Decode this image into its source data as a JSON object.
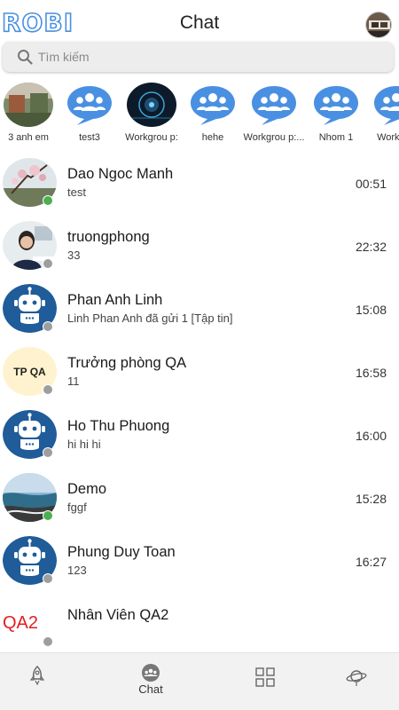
{
  "header": {
    "logo": "ROBI",
    "title": "Chat"
  },
  "search": {
    "placeholder": "Tìm kiếm"
  },
  "groups": [
    {
      "label": "3 anh em",
      "kind": "photo"
    },
    {
      "label": "test3",
      "kind": "group-icon"
    },
    {
      "label": "Workgrou p:",
      "kind": "photo"
    },
    {
      "label": "hehe",
      "kind": "group-icon"
    },
    {
      "label": "Workgrou p:...",
      "kind": "group-icon"
    },
    {
      "label": "Nhom 1",
      "kind": "group-icon"
    },
    {
      "label": "Workg p:",
      "kind": "group-icon"
    }
  ],
  "chats": [
    {
      "name": "Dao Ngoc Manh",
      "message": "test",
      "time": "00:51",
      "status": "online",
      "avatar": "photo-blossom"
    },
    {
      "name": "truongphong",
      "message": "33",
      "time": "22:32",
      "status": "offline",
      "avatar": "photo-woman"
    },
    {
      "name": "Phan Anh Linh",
      "message": "Linh Phan Anh đã gửi 1 [Tập tin]",
      "time": "15:08",
      "status": "offline",
      "avatar": "robot-icon"
    },
    {
      "name": "Trưởng phòng QA",
      "message": "11",
      "time": "16:58",
      "status": "offline",
      "avatar": "text",
      "avatar_text": "TP QA"
    },
    {
      "name": "Ho Thu Phuong",
      "message": "hi hi hi",
      "time": "16:00",
      "status": "offline",
      "avatar": "robot-icon"
    },
    {
      "name": "Demo",
      "message": "fggf",
      "time": "15:28",
      "status": "online",
      "avatar": "photo-coast"
    },
    {
      "name": "Phung Duy Toan",
      "message": "123",
      "time": "16:27",
      "status": "offline",
      "avatar": "robot-icon"
    },
    {
      "name": "Nhân Viên QA2",
      "message": "",
      "time": "",
      "status": "offline",
      "avatar": "text-red",
      "avatar_text": "QA2"
    }
  ],
  "nav": {
    "items": [
      {
        "icon": "rocket-icon",
        "label": ""
      },
      {
        "icon": "chat-group-icon",
        "label": "Chat"
      },
      {
        "icon": "grid-icon",
        "label": ""
      },
      {
        "icon": "planet-icon",
        "label": ""
      }
    ]
  },
  "colors": {
    "accent": "#4a90e2",
    "online": "#4caf50",
    "offline": "#9e9e9e",
    "robot_blue": "#1f5c99",
    "qa2_red": "#e02020"
  }
}
